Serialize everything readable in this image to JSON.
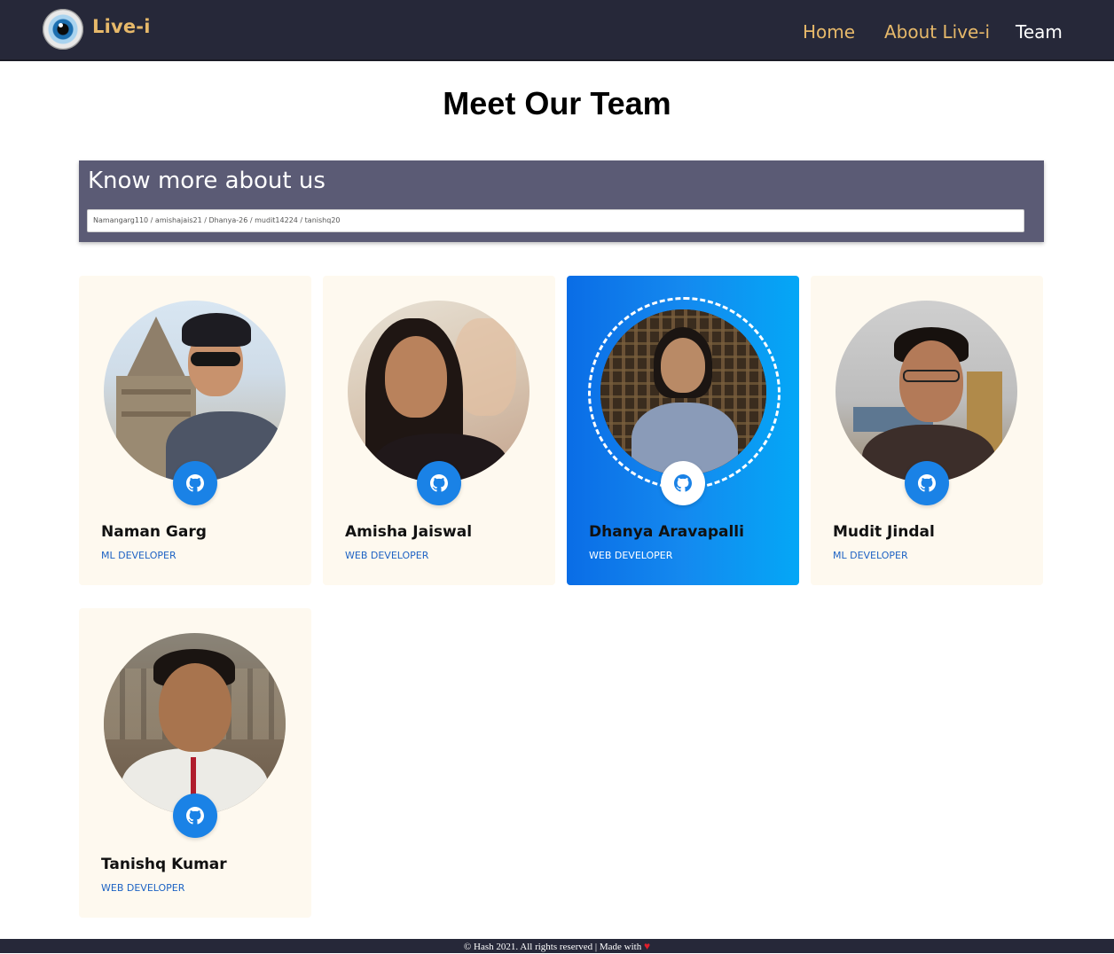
{
  "navbar": {
    "brand": "Live-i",
    "links": [
      {
        "label": "Home"
      },
      {
        "label": "About Live-i"
      },
      {
        "label": "Team"
      }
    ]
  },
  "page": {
    "title": "Meet Our Team"
  },
  "know_more": {
    "title": "Know more about us",
    "input_value": "Namangarg110 / amishajais21 / Dhanya-26 / mudit14224 / tanishq20"
  },
  "team": [
    {
      "name": "Naman Garg",
      "role": "ML DEVELOPER",
      "icon": "github-icon"
    },
    {
      "name": "Amisha Jaiswal",
      "role": "WEB DEVELOPER",
      "icon": "github-icon"
    },
    {
      "name": "Dhanya Aravapalli",
      "role": "WEB DEVELOPER",
      "icon": "github-icon"
    },
    {
      "name": "Mudit Jindal",
      "role": "ML DEVELOPER",
      "icon": "github-icon"
    },
    {
      "name": "Tanishq Kumar",
      "role": "WEB DEVELOPER",
      "icon": "github-icon"
    }
  ],
  "footer": {
    "text": "© Hash 2021. All rights reserved | Made with",
    "heart": "♥"
  },
  "colors": {
    "navbar_bg": "#262839",
    "nav_accent": "#e7b96a",
    "card_bg": "#fef9ef",
    "card_active_start": "#0a6de6",
    "card_active_end": "#04a7f6",
    "role_color": "#1d63c4",
    "github_button": "#1a82e6"
  }
}
